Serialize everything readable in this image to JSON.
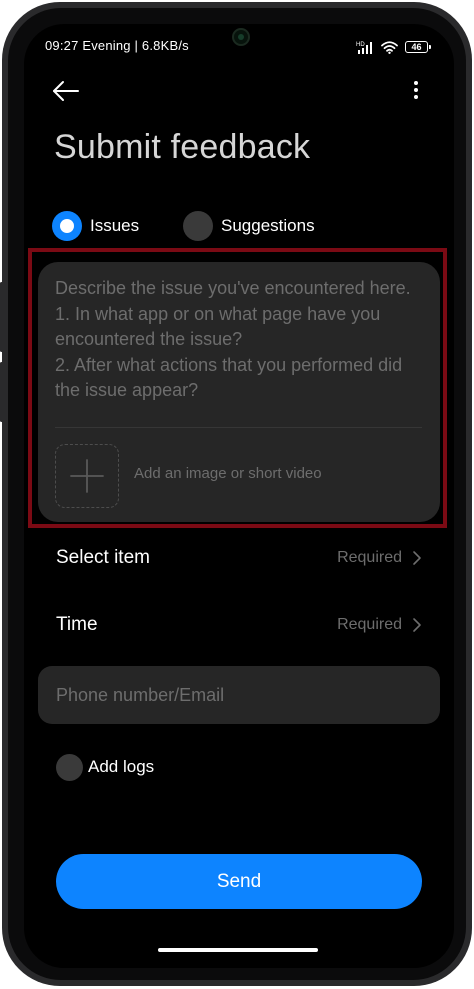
{
  "status_bar": {
    "time_and_speed": "09:27 Evening | 6.8KB/s",
    "network_label": "HD",
    "battery_level": "46"
  },
  "header": {
    "back_icon": "arrow-left-icon",
    "more_icon": "more-vertical-icon",
    "title": "Submit feedback"
  },
  "feedback_type": {
    "selected": "Issues",
    "options": [
      {
        "label": "Issues",
        "selected": true
      },
      {
        "label": "Suggestions",
        "selected": false
      }
    ]
  },
  "description": {
    "placeholder": "Describe the issue you've encountered here.\n1. In what app or on what page have you encountered the issue?\n2. After what actions that you performed did the issue appear?",
    "attachment_label": "Add an image or short video",
    "attachment_icon": "plus-icon"
  },
  "fields": [
    {
      "label": "Select item",
      "value": "Required"
    },
    {
      "label": "Time",
      "value": "Required"
    }
  ],
  "contact": {
    "placeholder": "Phone number/Email"
  },
  "logs": {
    "label": "Add logs",
    "checked": false
  },
  "send": {
    "label": "Send"
  },
  "colors": {
    "accent": "#0d84ff",
    "background": "#000000",
    "card": "#262626",
    "highlight_border": "#7b0a14"
  }
}
